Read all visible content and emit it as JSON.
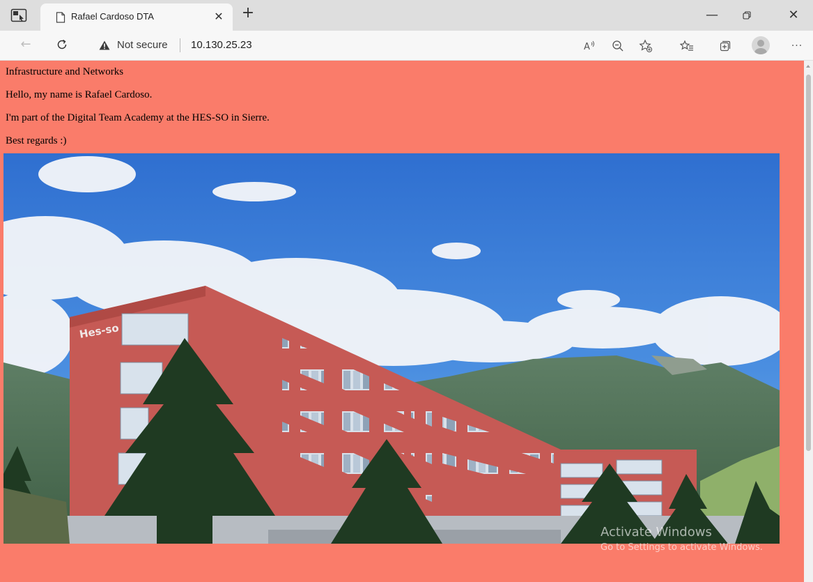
{
  "browser": {
    "tab": {
      "title": "Rafael Cardoso DTA"
    },
    "address": {
      "security_label": "Not secure",
      "url": "10.130.25.23"
    },
    "icons": {
      "workspaces": "workspaces-icon",
      "page": "page-icon",
      "close": "close-icon",
      "new_tab": "plus-icon",
      "back": "back-arrow-icon",
      "reload": "reload-icon",
      "warning": "warning-triangle-icon",
      "read_aloud": "read-aloud-icon",
      "zoom": "zoom-out-icon",
      "favorite": "add-favorite-icon",
      "favorites": "favorites-icon",
      "collections": "collections-icon",
      "profile": "profile-avatar",
      "more": "more-icon"
    },
    "window_buttons": {
      "minimize": "—",
      "restore": "restore-icon",
      "close": "✕"
    }
  },
  "page": {
    "background": "#fa7c6a",
    "lines": [
      "Infrastructure and Networks",
      "Hello, my name is Rafael Cardoso.",
      "I'm part of the Digital Team Academy at the HES-SO in Sierre."
    ],
    "closing": "Best regards :)",
    "photo": {
      "building_sign": "Hes-so"
    }
  },
  "watermark": {
    "title": "Activate Windows",
    "subtitle": "Go to Settings to activate Windows."
  }
}
